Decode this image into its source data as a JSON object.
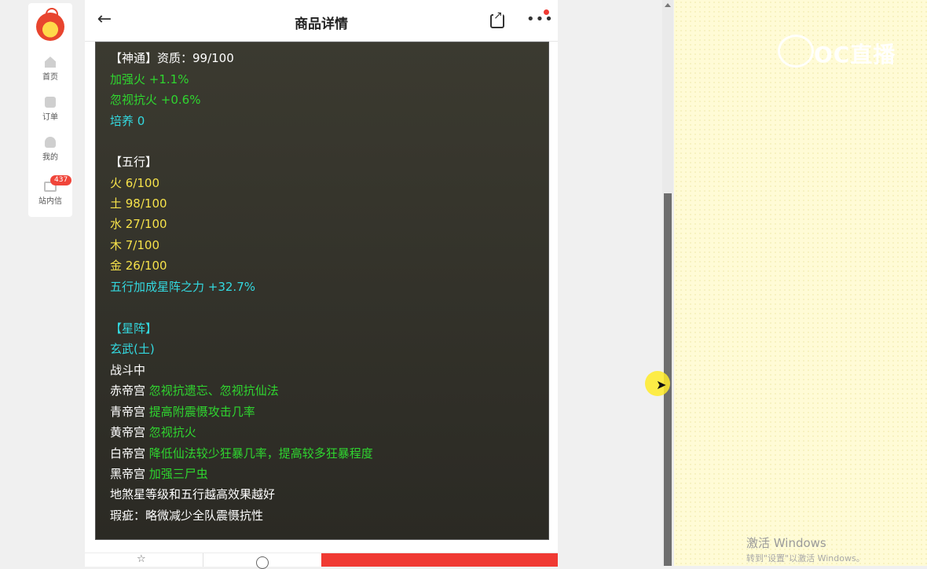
{
  "nav": {
    "items": [
      {
        "label": "首页",
        "icon": "home-icon"
      },
      {
        "label": "订单",
        "icon": "order-icon"
      },
      {
        "label": "我的",
        "icon": "user-icon"
      },
      {
        "label": "站内信",
        "icon": "mail-icon",
        "badge": "437"
      }
    ]
  },
  "header": {
    "back": "←",
    "title": "商品详情",
    "more": "•••"
  },
  "content": {
    "lines": [
      {
        "text": "【神通】资质：99/100",
        "color": "white"
      },
      {
        "text": "加强火 +1.1%",
        "color": "green"
      },
      {
        "text": "忽视抗火 +0.6%",
        "color": "green"
      },
      {
        "text": "培养 0",
        "color": "cyan"
      },
      {
        "text": "【五行】",
        "color": "white"
      },
      {
        "text": "火 6/100",
        "color": "yellow"
      },
      {
        "text": "土 98/100",
        "color": "yellow"
      },
      {
        "text": "水 27/100",
        "color": "yellow"
      },
      {
        "text": "木 7/100",
        "color": "yellow"
      },
      {
        "text": "金 26/100",
        "color": "yellow"
      },
      {
        "text": "五行加成星阵之力 +32.7%",
        "color": "cyan"
      },
      {
        "text": "【星阵】",
        "color": "cyan"
      },
      {
        "text": "玄武(土)",
        "color": "cyan"
      },
      {
        "text": "战斗中",
        "color": "white"
      },
      {
        "label": "赤帝宫",
        "effect": "忽视抗遗忘、忽视抗仙法"
      },
      {
        "label": "青帝宫",
        "effect": "提高附震慑攻击几率"
      },
      {
        "label": "黄帝宫",
        "effect": "忽视抗火"
      },
      {
        "label": "白帝宫",
        "effect": "降低仙法较少狂暴几率，提高较多狂暴程度"
      },
      {
        "label": "黑帝宫",
        "effect": "加强三尸虫"
      },
      {
        "text": "地煞星等级和五行越高效果越好",
        "color": "white"
      },
      {
        "text": "瑕疵：略微减少全队震慑抗性",
        "color": "white"
      }
    ]
  },
  "bottom": {
    "star": "☆"
  },
  "watermark": {
    "text": "OC直播"
  },
  "windows": {
    "activate": "激活 Windows",
    "hint": "转到\"设置\"以激活 Windows。"
  },
  "colors": {
    "white": "#ffffff",
    "green": "#2fd62f",
    "cyan": "#33d9e0",
    "yellow": "#f6e24a",
    "accent_red": "#f03a33"
  }
}
